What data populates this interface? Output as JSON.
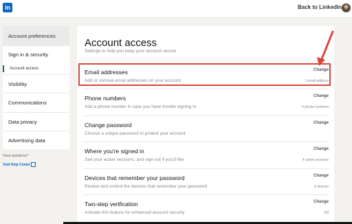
{
  "topbar": {
    "logo_text": "in",
    "back_link": "Back to LinkedIn"
  },
  "sidebar": {
    "title": "Account preferences",
    "items": [
      {
        "label": "Sign in & security"
      },
      {
        "label": "Account access"
      },
      {
        "label": "Visibility"
      },
      {
        "label": "Communications"
      },
      {
        "label": "Data privacy"
      },
      {
        "label": "Advertising data"
      }
    ],
    "help_question": "Have questions?",
    "help_link": "Visit Help Center"
  },
  "main": {
    "title": "Account access",
    "subtitle": "Settings to help you keep your account secure",
    "rows": [
      {
        "title": "Email addresses",
        "description": "Add or remove email addresses on your account",
        "action": "Change",
        "status": "1 email address"
      },
      {
        "title": "Phone numbers",
        "description": "Add a phone number in case you have trouble signing in",
        "action": "Change",
        "status": "0 phone numbers"
      },
      {
        "title": "Change password",
        "description": "Choose a unique password to protect your account",
        "action": "Change",
        "status": ""
      },
      {
        "title": "Where you're signed in",
        "description": "See your active sessions, and sign out if you'd like",
        "action": "Change",
        "status": "4 active sessions"
      },
      {
        "title": "Devices that remember your password",
        "description": "Review and control the devices that remember your password",
        "action": "Change",
        "status": "0 devices"
      },
      {
        "title": "Two-step verification",
        "description": "Activate this feature for enhanced account security",
        "action": "Change",
        "status": "Off"
      }
    ]
  },
  "colors": {
    "accent": "#0a66c2",
    "highlight": "#d9443b",
    "active_marker": "#057642"
  }
}
